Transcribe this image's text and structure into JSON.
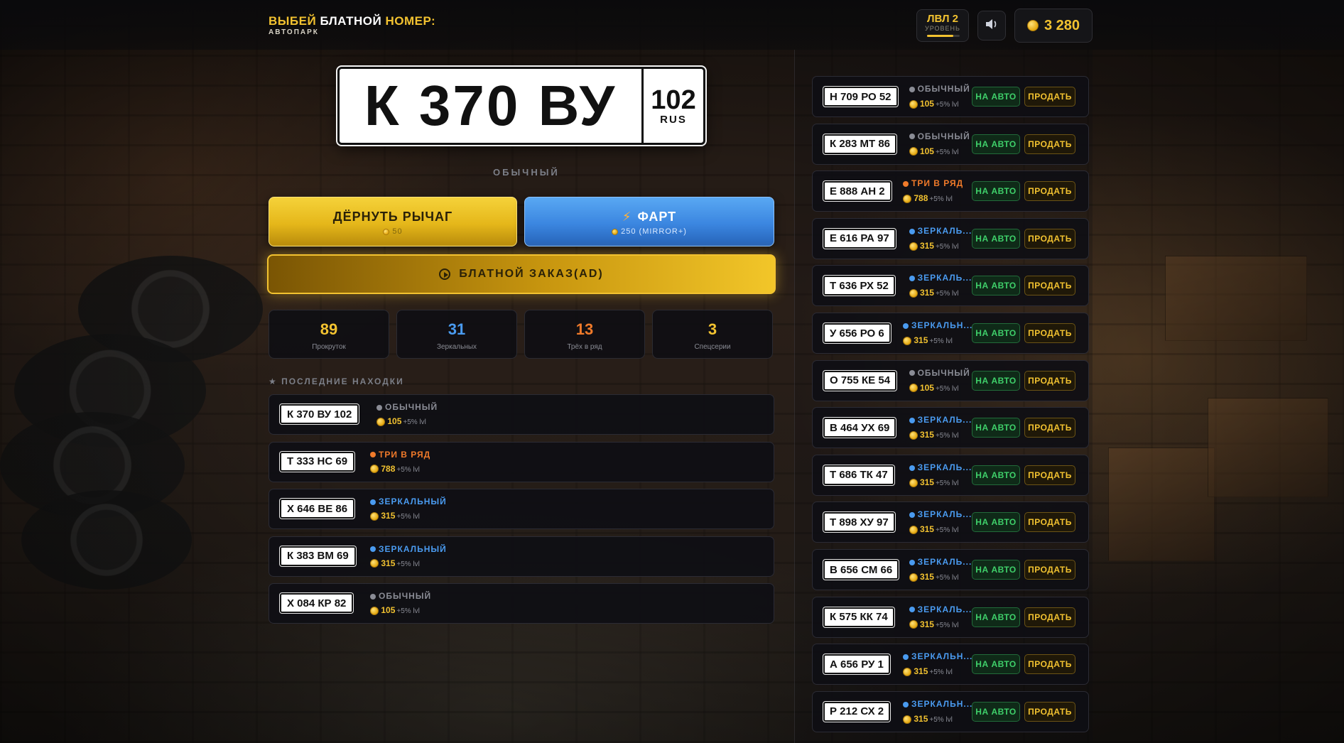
{
  "header": {
    "title_part1": "ВЫБЕЙ",
    "title_part2": "БЛАТНОЙ",
    "title_part3": "НОМЕР:",
    "subtitle": "АВТОПАРК",
    "level": "ЛВЛ 2",
    "level_caption": "УРОВЕНЬ",
    "level_progress": 0.8,
    "coins": "3 280"
  },
  "current_plate": {
    "main": "К 370 ВУ",
    "region": "102",
    "country": "RUS",
    "rarity": "ОБЫЧНЫЙ"
  },
  "buttons": {
    "lever": {
      "label": "ДЁРНУТЬ РЫЧАГ",
      "cost": "50"
    },
    "fart": {
      "label": "ФАРТ",
      "cost": "250 (MIRROR+)"
    },
    "order": {
      "label": "БЛАТНОЙ ЗАКАЗ(AD)"
    }
  },
  "stats": [
    {
      "value": "89",
      "label": "Прокруток",
      "color": "#f2c230"
    },
    {
      "value": "31",
      "label": "Зеркальных",
      "color": "#4a9bf0"
    },
    {
      "value": "13",
      "label": "Трёх в ряд",
      "color": "#f07a2a"
    },
    {
      "value": "3",
      "label": "Спецсерии",
      "color": "#f2c230"
    }
  ],
  "recent": {
    "title": "★ ПОСЛЕДНИЕ НАХОДКИ",
    "items": [
      {
        "plate": "К 370 ВУ 102",
        "rarity": "ОБЫЧНЫЙ",
        "rarity_color": "#8a8c95",
        "price": "105",
        "bonus": "+5% lvl"
      },
      {
        "plate": "Т 333 НС 69",
        "rarity": "ТРИ В РЯД",
        "rarity_color": "#f07a2a",
        "price": "788",
        "bonus": "+5% lvl"
      },
      {
        "plate": "Х 646 ВЕ 86",
        "rarity": "ЗЕРКАЛЬНЫЙ",
        "rarity_color": "#4a9bf0",
        "price": "315",
        "bonus": "+5% lvl"
      },
      {
        "plate": "К 383 ВМ 69",
        "rarity": "ЗЕРКАЛЬНЫЙ",
        "rarity_color": "#4a9bf0",
        "price": "315",
        "bonus": "+5% lvl"
      },
      {
        "plate": "Х 084 КР 82",
        "rarity": "ОБЫЧНЫЙ",
        "rarity_color": "#8a8c95",
        "price": "105",
        "bonus": "+5% lvl"
      }
    ]
  },
  "garage": {
    "to_car_label": "НА АВТО",
    "sell_label": "ПРОДАТЬ",
    "items": [
      {
        "plate": "Н 709 РО 52",
        "rarity": "ОБЫЧНЫЙ",
        "rarity_color": "#8a8c95",
        "price": "105",
        "bonus": "+5% lvl"
      },
      {
        "plate": "К 283 МТ 86",
        "rarity": "ОБЫЧНЫЙ",
        "rarity_color": "#8a8c95",
        "price": "105",
        "bonus": "+5% lvl"
      },
      {
        "plate": "Е 888 АН 2",
        "rarity": "ТРИ В РЯД",
        "rarity_color": "#f07a2a",
        "price": "788",
        "bonus": "+5% lvl"
      },
      {
        "plate": "Е 616 РА 97",
        "rarity": "ЗЕРКАЛЬ...",
        "rarity_color": "#4a9bf0",
        "price": "315",
        "bonus": "+5% lvl"
      },
      {
        "plate": "Т 636 РХ 52",
        "rarity": "ЗЕРКАЛЬ...",
        "rarity_color": "#4a9bf0",
        "price": "315",
        "bonus": "+5% lvl"
      },
      {
        "plate": "У 656 РО 6",
        "rarity": "ЗЕРКАЛЬН...",
        "rarity_color": "#4a9bf0",
        "price": "315",
        "bonus": "+5% lvl"
      },
      {
        "plate": "О 755 КЕ 54",
        "rarity": "ОБЫЧНЫЙ",
        "rarity_color": "#8a8c95",
        "price": "105",
        "bonus": "+5% lvl"
      },
      {
        "plate": "В 464 УХ 69",
        "rarity": "ЗЕРКАЛЬ...",
        "rarity_color": "#4a9bf0",
        "price": "315",
        "bonus": "+5% lvl"
      },
      {
        "plate": "Т 686 ТК 47",
        "rarity": "ЗЕРКАЛЬ...",
        "rarity_color": "#4a9bf0",
        "price": "315",
        "bonus": "+5% lvl"
      },
      {
        "plate": "Т 898 ХУ 97",
        "rarity": "ЗЕРКАЛЬ...",
        "rarity_color": "#4a9bf0",
        "price": "315",
        "bonus": "+5% lvl"
      },
      {
        "plate": "В 656 СМ 66",
        "rarity": "ЗЕРКАЛЬ...",
        "rarity_color": "#4a9bf0",
        "price": "315",
        "bonus": "+5% lvl"
      },
      {
        "plate": "К 575 КК 74",
        "rarity": "ЗЕРКАЛЬ...",
        "rarity_color": "#4a9bf0",
        "price": "315",
        "bonus": "+5% lvl"
      },
      {
        "plate": "А 656 РУ 1",
        "rarity": "ЗЕРКАЛЬН...",
        "rarity_color": "#4a9bf0",
        "price": "315",
        "bonus": "+5% lvl"
      },
      {
        "plate": "Р 212 СХ 2",
        "rarity": "ЗЕРКАЛЬН...",
        "rarity_color": "#4a9bf0",
        "price": "315",
        "bonus": "+5% lvl"
      }
    ]
  }
}
